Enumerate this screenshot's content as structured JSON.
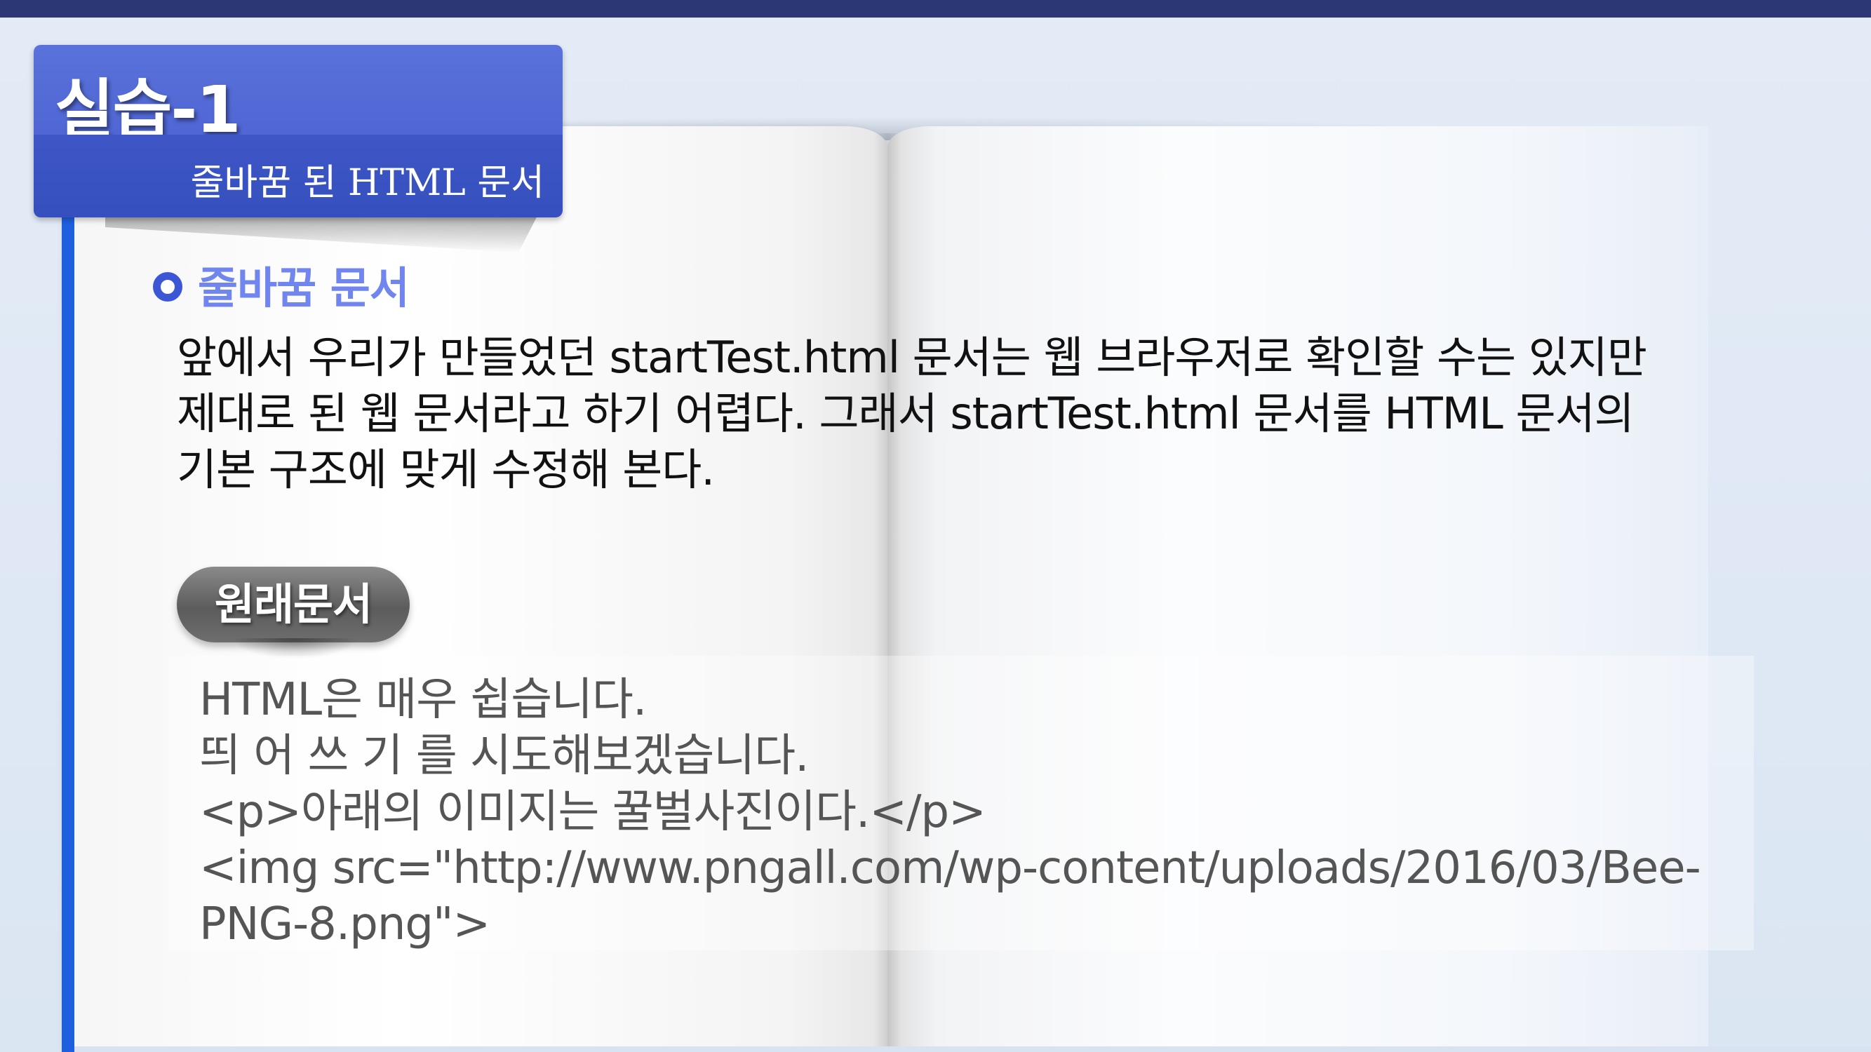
{
  "header": {
    "title": "실습-1",
    "subtitle": "줄바꿈 된 HTML 문서"
  },
  "section": {
    "heading": "줄바꿈 문서",
    "paragraph_lines": [
      "앞에서 우리가 만들었던 startTest.html 문서는 웹 브라우저로 확인할 수는 있지만",
      "제대로 된 웹 문서라고 하기 어렵다. 그래서 startTest.html 문서를 HTML 문서의",
      "기본 구조에 맞게 수정해 본다."
    ]
  },
  "original": {
    "badge": "원래문서",
    "code_lines": [
      "HTML은 매우 쉽습니다.",
      "띄 어 쓰 기 를 시도해보겠습니다.",
      "<p>아래의 이미지는 꿀벌사진이다.</p>",
      "<img src=\"http://www.pngall.com/wp-content/uploads/2016/03/Bee-",
      "PNG-8.png\">"
    ]
  },
  "colors": {
    "top_bar": "#2c3775",
    "tab_top": "#5a72da",
    "tab_bottom": "#3f56c6",
    "accent_bar": "#1e5fe0",
    "heading": "#7086ee",
    "badge": "#6e6e6e"
  }
}
